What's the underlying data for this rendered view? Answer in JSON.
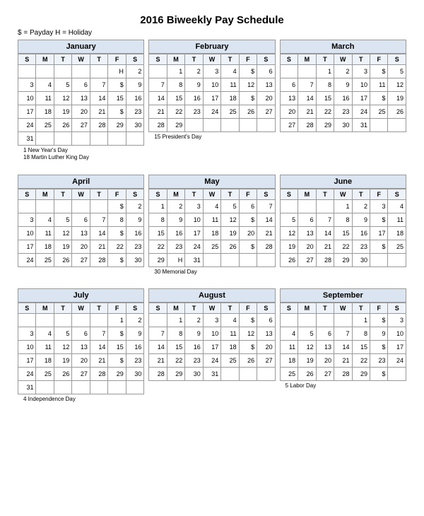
{
  "title": "2016 Biweekly Pay Schedule",
  "legend": "$ = Payday      H = Holiday",
  "dow": [
    "S",
    "M",
    "T",
    "W",
    "T",
    "F",
    "S"
  ],
  "months": [
    {
      "name": "January",
      "start": 5,
      "days": 31,
      "override": {
        "1": "H",
        "8": "$",
        "22": "$"
      },
      "notes": [
        "1 New Year's Day",
        "18 Martin Luther King Day"
      ]
    },
    {
      "name": "February",
      "start": 1,
      "days": 29,
      "override": {
        "5": "$",
        "19": "$"
      },
      "notes": [
        "15 President's Day"
      ]
    },
    {
      "name": "March",
      "start": 2,
      "days": 31,
      "override": {
        "4": "$",
        "18": "$"
      },
      "notes": []
    },
    {
      "name": "April",
      "start": 5,
      "days": 30,
      "override": {
        "1": "$",
        "15": "$",
        "29": "$"
      },
      "notes": []
    },
    {
      "name": "May",
      "start": 0,
      "days": 31,
      "override": {
        "13": "$",
        "27": "$",
        "30": "H"
      },
      "notes": [
        "30 Memorial Day"
      ]
    },
    {
      "name": "June",
      "start": 3,
      "days": 30,
      "override": {
        "10": "$",
        "24": "$"
      },
      "notes": []
    },
    {
      "name": "July",
      "start": 5,
      "days": 31,
      "override": {
        "8": "$",
        "22": "$"
      },
      "notes": [
        "4 Independence Day"
      ]
    },
    {
      "name": "August",
      "start": 1,
      "days": 31,
      "override": {
        "5": "$",
        "19": "$"
      },
      "notes": []
    },
    {
      "name": "September",
      "start": 4,
      "days": 30,
      "override": {
        "2": "$",
        "16": "$",
        "30": "$"
      },
      "notes": [
        "5 Labor Day"
      ]
    }
  ]
}
